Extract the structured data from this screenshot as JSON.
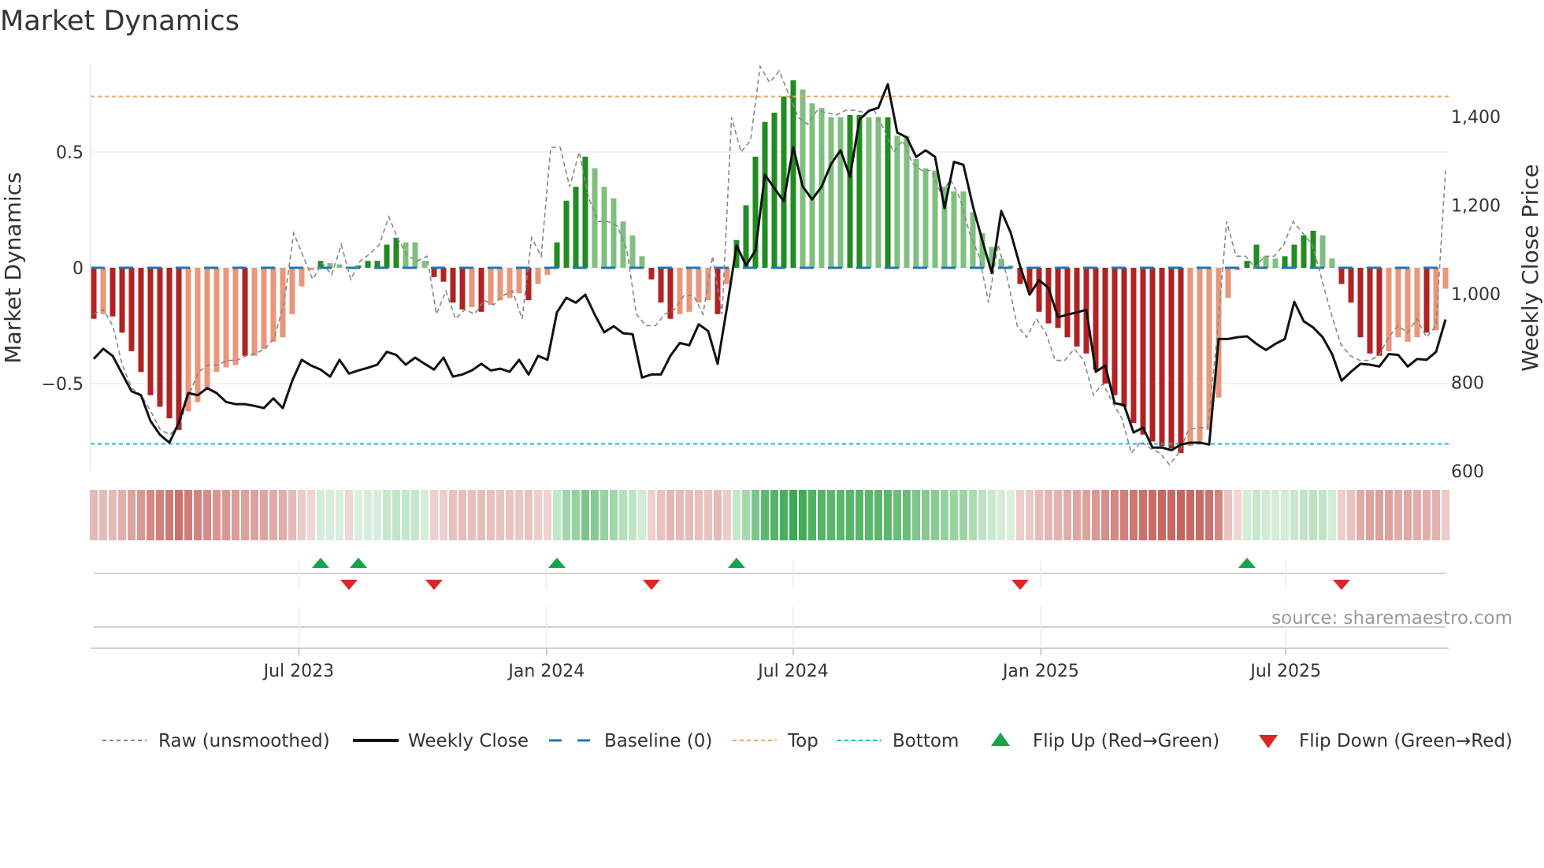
{
  "chart_data": {
    "type": "bar",
    "title": "Market Dynamics",
    "ylabel": "Market Dynamics",
    "y2label": "Weekly Close Price",
    "source": "source: sharemaestro.com",
    "ylim": [
      -0.88,
      0.88
    ],
    "y2lim": [
      600,
      1520
    ],
    "yticks": [
      {
        "v": 0.5,
        "label": "0.5"
      },
      {
        "v": 0,
        "label": "0"
      },
      {
        "v": -0.5,
        "label": "−0.5"
      }
    ],
    "y2ticks": [
      {
        "v": 1400,
        "label": "1,400"
      },
      {
        "v": 1200,
        "label": "1,200"
      },
      {
        "v": 1000,
        "label": "1,000"
      },
      {
        "v": 800,
        "label": "800"
      },
      {
        "v": 600,
        "label": "600"
      }
    ],
    "xticks": [
      {
        "week": 21.7,
        "label": "Jul 2023"
      },
      {
        "week": 47.9,
        "label": "Jan 2024"
      },
      {
        "week": 74.0,
        "label": "Jul 2024"
      },
      {
        "week": 100.2,
        "label": "Jan 2025"
      },
      {
        "week": 126.1,
        "label": "Jul 2025"
      }
    ],
    "top": 0.74,
    "bottom": -0.76,
    "baseline": 0,
    "dynamics": [
      -0.22,
      -0.2,
      -0.21,
      -0.28,
      -0.36,
      -0.45,
      -0.55,
      -0.6,
      -0.65,
      -0.7,
      -0.62,
      -0.58,
      -0.52,
      -0.45,
      -0.43,
      -0.42,
      -0.38,
      -0.38,
      -0.35,
      -0.32,
      -0.3,
      -0.2,
      -0.08,
      -0.01,
      0.03,
      0.02,
      0.015,
      -0.005,
      0.01,
      0.03,
      0.03,
      0.1,
      0.13,
      0.11,
      0.11,
      0.03,
      -0.04,
      -0.06,
      -0.15,
      -0.18,
      -0.17,
      -0.19,
      -0.16,
      -0.14,
      -0.13,
      -0.11,
      -0.14,
      -0.07,
      -0.03,
      0.11,
      0.29,
      0.35,
      0.48,
      0.43,
      0.35,
      0.3,
      0.2,
      0.14,
      0.05,
      -0.05,
      -0.15,
      -0.22,
      -0.2,
      -0.19,
      -0.15,
      -0.14,
      -0.2,
      -0.07,
      0.12,
      0.27,
      0.48,
      0.63,
      0.67,
      0.74,
      0.81,
      0.77,
      0.71,
      0.69,
      0.65,
      0.65,
      0.66,
      0.66,
      0.65,
      0.65,
      0.65,
      0.57,
      0.57,
      0.47,
      0.43,
      0.42,
      0.35,
      0.33,
      0.33,
      0.24,
      0.15,
      0.09,
      0.04,
      0.01,
      -0.07,
      -0.1,
      -0.19,
      -0.24,
      -0.26,
      -0.3,
      -0.34,
      -0.37,
      -0.44,
      -0.5,
      -0.55,
      -0.6,
      -0.67,
      -0.72,
      -0.75,
      -0.77,
      -0.78,
      -0.8,
      -0.77,
      -0.75,
      -0.7,
      -0.56,
      -0.13,
      -0.01,
      0.03,
      0.1,
      0.05,
      0.04,
      0.05,
      0.1,
      0.14,
      0.16,
      0.14,
      0.04,
      -0.07,
      -0.15,
      -0.3,
      -0.37,
      -0.38,
      -0.36,
      -0.3,
      -0.32,
      -0.3,
      -0.28,
      -0.27,
      -0.09
    ],
    "strong": [
      1,
      0,
      1,
      1,
      1,
      1,
      1,
      1,
      1,
      1,
      0,
      0,
      0,
      0,
      0,
      0,
      1,
      0,
      0,
      0,
      0,
      0,
      0,
      0,
      1,
      0,
      0,
      0,
      1,
      1,
      1,
      1,
      1,
      0,
      0,
      0,
      1,
      1,
      1,
      1,
      0,
      1,
      0,
      0,
      0,
      0,
      1,
      0,
      0,
      1,
      1,
      1,
      1,
      0,
      0,
      0,
      0,
      0,
      0,
      1,
      1,
      1,
      0,
      0,
      0,
      0,
      1,
      0,
      1,
      1,
      1,
      1,
      1,
      1,
      1,
      0,
      0,
      0,
      0,
      0,
      1,
      1,
      0,
      0,
      1,
      0,
      0,
      0,
      0,
      0,
      0,
      0,
      0,
      0,
      0,
      0,
      0,
      0,
      1,
      1,
      1,
      1,
      1,
      1,
      1,
      1,
      1,
      1,
      1,
      1,
      1,
      1,
      1,
      1,
      1,
      1,
      0,
      0,
      0,
      0,
      0,
      0,
      1,
      1,
      0,
      0,
      1,
      1,
      1,
      1,
      0,
      0,
      1,
      1,
      1,
      1,
      1,
      0,
      0,
      0,
      0,
      1,
      0,
      0
    ],
    "raw": [
      -0.2,
      -0.18,
      -0.25,
      -0.42,
      -0.52,
      -0.55,
      -0.62,
      -0.7,
      -0.72,
      -0.68,
      -0.55,
      -0.45,
      -0.42,
      -0.42,
      -0.4,
      -0.4,
      -0.38,
      -0.37,
      -0.35,
      -0.3,
      -0.15,
      0.15,
      0.05,
      -0.05,
      0.02,
      -0.03,
      0.1,
      -0.05,
      0.03,
      0.06,
      0.1,
      0.22,
      0.12,
      0.05,
      0.03,
      0.05,
      -0.2,
      -0.1,
      -0.22,
      -0.18,
      -0.2,
      -0.14,
      -0.16,
      -0.12,
      -0.1,
      -0.22,
      0.13,
      0.05,
      0.52,
      0.52,
      0.35,
      0.5,
      0.3,
      0.2,
      0.2,
      0.18,
      0.08,
      -0.2,
      -0.25,
      -0.25,
      -0.2,
      -0.18,
      -0.12,
      -0.12,
      -0.2,
      0.05,
      -0.2,
      0.65,
      0.5,
      0.55,
      0.87,
      0.8,
      0.85,
      0.75,
      0.65,
      0.62,
      0.68,
      0.67,
      0.66,
      0.68,
      0.68,
      0.67,
      0.68,
      0.6,
      0.5,
      0.55,
      0.45,
      0.42,
      0.42,
      0.32,
      0.38,
      0.3,
      0.15,
      0.05,
      -0.15,
      0.1,
      -0.05,
      -0.25,
      -0.3,
      -0.22,
      -0.28,
      -0.4,
      -0.4,
      -0.35,
      -0.4,
      -0.55,
      -0.5,
      -0.58,
      -0.65,
      -0.8,
      -0.75,
      -0.78,
      -0.8,
      -0.85,
      -0.8,
      -0.7,
      -0.69,
      -0.69,
      -0.3,
      0.2,
      0.05,
      0.05,
      0.0,
      0.05,
      0.05,
      0.1,
      0.2,
      0.15,
      0.1,
      -0.05,
      -0.2,
      -0.33,
      -0.38,
      -0.4,
      -0.4,
      -0.38,
      -0.3,
      -0.25,
      -0.28,
      -0.22,
      -0.3,
      -0.25,
      0.42
    ],
    "close": [
      853,
      876,
      860,
      820,
      780,
      771,
      713,
      682,
      664,
      709,
      776,
      771,
      787,
      776,
      756,
      751,
      751,
      747,
      742,
      764,
      742,
      804,
      851,
      838,
      829,
      813,
      851,
      820,
      827,
      833,
      840,
      869,
      862,
      840,
      856,
      842,
      829,
      856,
      813,
      818,
      827,
      842,
      827,
      831,
      824,
      851,
      818,
      860,
      851,
      958,
      991,
      980,
      998,
      953,
      913,
      927,
      911,
      909,
      811,
      818,
      818,
      860,
      889,
      884,
      931,
      916,
      842,
      971,
      1109,
      1064,
      1098,
      1269,
      1238,
      1209,
      1331,
      1242,
      1213,
      1242,
      1293,
      1324,
      1264,
      1393,
      1413,
      1420,
      1473,
      1364,
      1353,
      1309,
      1324,
      1309,
      1193,
      1298,
      1291,
      1198,
      1120,
      1047,
      1187,
      1138,
      1062,
      998,
      1031,
      1013,
      947,
      953,
      958,
      964,
      824,
      838,
      753,
      749,
      687,
      698,
      653,
      653,
      647,
      660,
      664,
      664,
      660,
      898,
      898,
      902,
      904,
      887,
      873,
      887,
      898,
      982,
      938,
      924,
      902,
      864,
      804,
      824,
      842,
      840,
      836,
      864,
      862,
      836,
      853,
      851,
      869,
      942
    ],
    "flips_up_week": [
      24,
      28,
      49,
      68,
      122
    ],
    "flips_down_week": [
      27,
      36,
      59,
      98,
      132
    ],
    "legend": [
      {
        "label": "Raw (unsmoothed)",
        "icon": "dashed-line",
        "color": "#888888"
      },
      {
        "label": "Weekly Close",
        "icon": "solid-line",
        "color": "#111111"
      },
      {
        "label": "Baseline (0)",
        "icon": "dashed-line",
        "color": "#1f77b4"
      },
      {
        "label": "Top",
        "icon": "dotted-line",
        "color": "#f4a460"
      },
      {
        "label": "Bottom",
        "icon": "dotted-line",
        "color": "#17becf"
      },
      {
        "label": "Flip Up (Red→Green)",
        "icon": "triangle-up",
        "color": "#16a34a"
      },
      {
        "label": "Flip Down (Green→Red)",
        "icon": "triangle-down",
        "color": "#dc2626"
      }
    ],
    "legend_position": "bottom",
    "colors": {
      "strong_pos": "#228b22",
      "weak_pos": "#7fbf7f",
      "strong_neg": "#b22222",
      "weak_neg": "#e9967a",
      "close": "#111111",
      "raw": "#888888",
      "baseline": "#1f77b4",
      "top": "#f4a460",
      "bottom": "#17becf",
      "up": "#16a34a",
      "down": "#dc2626"
    }
  }
}
